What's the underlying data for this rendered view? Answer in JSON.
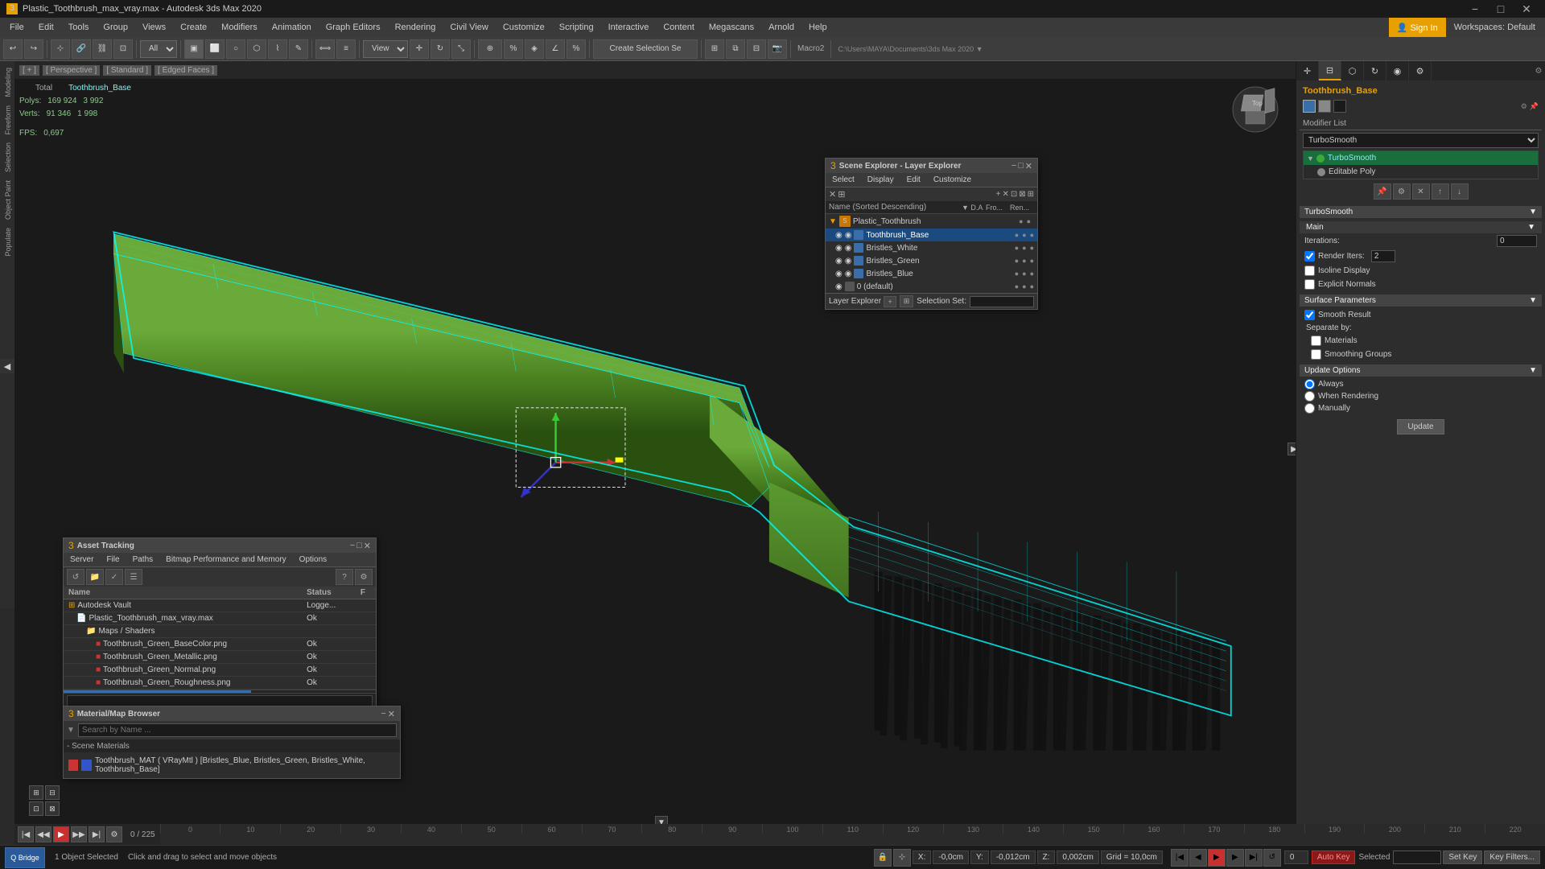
{
  "title_bar": {
    "title": "Plastic_Toothbrush_max_vray.max - Autodesk 3ds Max 2020",
    "close": "✕",
    "maximize": "□",
    "minimize": "−"
  },
  "menu": {
    "items": [
      "File",
      "Edit",
      "Tools",
      "Group",
      "Views",
      "Create",
      "Modifiers",
      "Animation",
      "Graph Editors",
      "Rendering",
      "Civil View",
      "Customize",
      "Scripting",
      "Interactive",
      "Content",
      "Megascans",
      "Arnold",
      "Help"
    ]
  },
  "toolbar": {
    "view_label": "View",
    "create_selection": "Create Selection Se",
    "macro_label": "Macro2",
    "workspaces": "Workspaces:",
    "default": "Default",
    "sign_in": "Sign In"
  },
  "viewport": {
    "perspective": "[ + ] [ Perspective ] [ Standard ] [ Edged Faces ]",
    "tags": [
      "[ + ]",
      "[ Perspective ]",
      "[ Standard ]",
      "[ Edged Faces ]"
    ],
    "stats": {
      "polys_label": "Polys:",
      "polys_total": "169 924",
      "polys_count": "3 992",
      "verts_label": "Verts:",
      "verts_total": "91 346",
      "verts_count": "1 998",
      "fps_label": "FPS:",
      "fps_value": "0,697",
      "total_label": "Total",
      "object_label": "Toothbrush_Base"
    }
  },
  "scene_explorer": {
    "title": "Scene Explorer - Layer Explorer",
    "menus": [
      "Select",
      "Display",
      "Edit",
      "Customize"
    ],
    "columns": {
      "name": "Name (Sorted Descending)",
      "d": "▼ D.A",
      "from": "Fro...",
      "render": "Ren..."
    },
    "items": [
      {
        "id": "plastic",
        "name": "Plastic_Toothbrush",
        "indent": 0,
        "type": "scene"
      },
      {
        "id": "base",
        "name": "Toothbrush_Base",
        "indent": 1,
        "type": "object",
        "selected": true
      },
      {
        "id": "white",
        "name": "Bristles_White",
        "indent": 1,
        "type": "object"
      },
      {
        "id": "green",
        "name": "Bristles_Green",
        "indent": 1,
        "type": "object"
      },
      {
        "id": "blue",
        "name": "Bristles_Blue",
        "indent": 1,
        "type": "object"
      },
      {
        "id": "default",
        "name": "0 (default)",
        "indent": 1,
        "type": "layer"
      }
    ],
    "footer": {
      "layer_explorer": "Layer Explorer",
      "selection_set": "Selection Set:"
    }
  },
  "asset_tracking": {
    "title": "Asset Tracking",
    "menus": [
      "Server",
      "File",
      "Paths",
      "Bitmap Performance and Memory",
      "Options"
    ],
    "columns": [
      "Name",
      "Status",
      "F"
    ],
    "items": [
      {
        "name": "Autodesk Vault",
        "status": "Logge...",
        "indent": 0,
        "type": "vault"
      },
      {
        "name": "Plastic_Toothbrush_max_vray.max",
        "status": "Ok",
        "indent": 1,
        "type": "file"
      },
      {
        "name": "Maps / Shaders",
        "status": "",
        "indent": 2,
        "type": "folder"
      },
      {
        "name": "Toothbrush_Green_BaseColor.png",
        "status": "Ok",
        "indent": 3,
        "type": "map"
      },
      {
        "name": "Toothbrush_Green_Metallic.png",
        "status": "Ok",
        "indent": 3,
        "type": "map"
      },
      {
        "name": "Toothbrush_Green_Normal.png",
        "status": "Ok",
        "indent": 3,
        "type": "map"
      },
      {
        "name": "Toothbrush_Green_Roughness.png",
        "status": "Ok",
        "indent": 3,
        "type": "map"
      }
    ]
  },
  "material_browser": {
    "title": "Material/Map Browser",
    "search_placeholder": "Search by Name ...",
    "section_title": "- Scene Materials",
    "item_label": "Toothbrush_MAT ( VRayMtl ) [Bristles_Blue, Bristles_Green, Bristles_White, Toothbrush_Base]"
  },
  "modifier_panel": {
    "title": "Toothbrush_Base",
    "modifier_list_label": "Modifier List",
    "modifiers": [
      {
        "name": "TurboSmooth",
        "active": true
      },
      {
        "name": "Editable Poly",
        "active": false
      }
    ],
    "turbosmooth": {
      "title": "TurboSmooth",
      "main": "Main",
      "iterations_label": "Iterations:",
      "iterations_value": "0",
      "render_iters_label": "Render Iters:",
      "render_iters_value": "2",
      "isoline_display": "Isoline Display",
      "explicit_normals": "Explicit Normals",
      "surface_parameters": "Surface Parameters",
      "smooth_result": "Smooth Result",
      "separate_by": "Separate by:",
      "materials": "Materials",
      "smoothing_groups": "Smoothing Groups",
      "update_options": "Update Options",
      "always": "Always",
      "when_rendering": "When Rendering",
      "manually": "Manually",
      "update_btn": "Update"
    }
  },
  "timeline": {
    "frame_current": "0",
    "frame_total": "225",
    "numbers": [
      "0",
      "10",
      "20",
      "30",
      "40",
      "50",
      "60",
      "70",
      "80",
      "90",
      "100",
      "110",
      "120",
      "130",
      "140",
      "150",
      "160",
      "170",
      "180",
      "190",
      "200",
      "210",
      "220"
    ]
  },
  "status_bar": {
    "object_count": "1 Object Selected",
    "message": "Click and drag to select and move objects",
    "x_label": "X:",
    "x_value": "-0,0cm",
    "y_label": "Y:",
    "y_value": "-0,012cm",
    "z_label": "Z:",
    "z_value": "0,002cm",
    "grid_label": "Grid = 10,0cm",
    "auto_key": "Auto Key",
    "selected": "Selected",
    "set_key": "Set Key",
    "key_filters": "Key Filters..."
  },
  "left_panel_tabs": [
    "Modeling",
    "Freeform",
    "Selection",
    "Object Paint",
    "Populate"
  ],
  "icons": {
    "close": "✕",
    "minimize_win": "−",
    "maximize_win": "□",
    "arrow_right": "▶",
    "arrow_down": "▼",
    "arrow_up": "▲",
    "arrow_left": "◀",
    "check": "✓",
    "eye": "◉",
    "lock": "🔒",
    "filter": "⊞",
    "folder": "📁",
    "file": "📄",
    "camera": "📷"
  }
}
